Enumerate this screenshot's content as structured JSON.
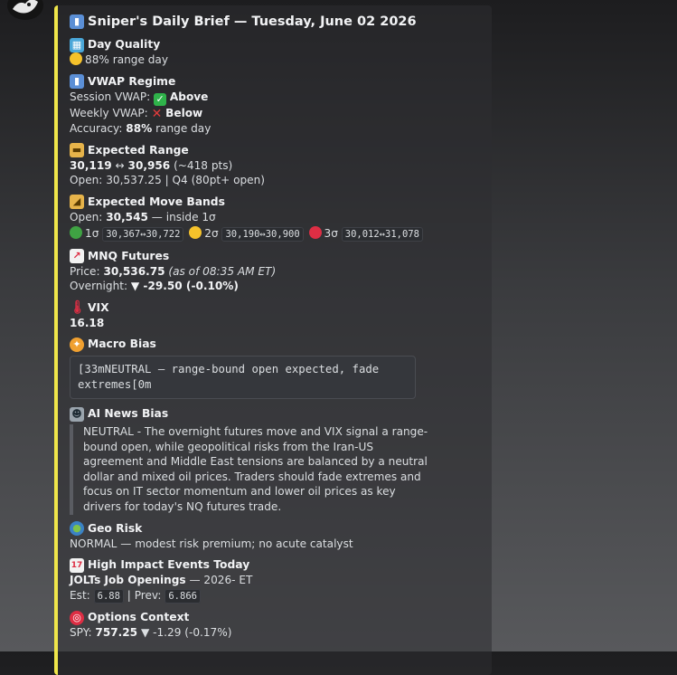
{
  "title": "Sniper's Daily Brief — Tuesday, June 02 2026",
  "day_quality": {
    "label": "Day Quality",
    "value": "88% range day"
  },
  "vwap": {
    "label": "VWAP Regime",
    "session_prefix": "Session VWAP:",
    "session_value": "Above",
    "weekly_prefix": "Weekly VWAP:",
    "weekly_value": "Below",
    "accuracy_prefix": "Accuracy:",
    "accuracy_value": "88%",
    "accuracy_suffix": "range day"
  },
  "expected_range": {
    "label": "Expected Range",
    "low": "30,119",
    "arrow": "↔",
    "high": "30,956",
    "pts": "(~418 pts)",
    "open_line": "Open: 30,537.25 | Q4 (80pt+ open)"
  },
  "bands": {
    "label": "Expected Move Bands",
    "open_prefix": "Open:",
    "open_value": "30,545",
    "open_suffix": "— inside 1σ",
    "s1_label": "1σ",
    "s1_value": "30,367↔30,722",
    "s2_label": "2σ",
    "s2_value": "30,190↔30,900",
    "s3_label": "3σ",
    "s3_value": "30,012↔31,078",
    "colors": {
      "s1": "#3fa243",
      "s2": "#f5c22b",
      "s3": "#dd2e44"
    }
  },
  "mnq": {
    "label": "MNQ Futures",
    "price_prefix": "Price:",
    "price_value": "30,536.75",
    "price_time": "(as of 08:35 AM ET)",
    "overnight_prefix": "Overnight:",
    "overnight_value": "▼ -29.50 (-0.10%)"
  },
  "vix": {
    "label": "VIX",
    "value": "16.18"
  },
  "macro": {
    "label": "Macro Bias",
    "code": "[33mNEUTRAL — range-bound open expected, fade\nextremes[0m"
  },
  "ai_news": {
    "label": "AI News Bias",
    "text": "NEUTRAL - The overnight futures move and VIX signal a range-bound open, while geopolitical risks from the Iran-US agreement and Middle East tensions are balanced by a neutral dollar and mixed oil prices. Traders should fade extremes and focus on IT sector momentum and lower oil prices as key drivers for today's NQ futures trade."
  },
  "geo": {
    "label": "Geo Risk",
    "value": "NORMAL — modest risk premium; no acute catalyst"
  },
  "events": {
    "label": "High Impact Events Today",
    "event_name": "JOLTs Job Openings",
    "event_time": "— 2026- ET",
    "est_prefix": "Est:",
    "est_value": "6.88",
    "sep": "| Prev:",
    "prev_value": "6.866"
  },
  "options": {
    "label": "Options Context",
    "spy_prefix": "SPY:",
    "spy_value": "757.25",
    "spy_change": "▼ -1.29 (-0.17%)"
  },
  "icons": {
    "title": "bar-chart-icon",
    "day_quality": "map-icon",
    "vwap": "bar-chart-icon",
    "range": "ruler-icon",
    "bands": "triangle-ruler-icon",
    "mnq": "chart-increasing-icon",
    "vix": "thermometer-icon",
    "macro": "compass-icon",
    "ai": "robot-icon",
    "geo": "globe-icon",
    "events": "calendar-icon",
    "options": "target-icon"
  },
  "accent_color": "#f0e64a"
}
